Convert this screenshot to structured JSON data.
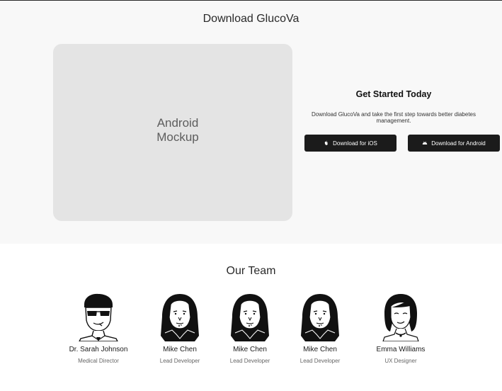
{
  "download": {
    "title": "Download GlucoVa",
    "mockup_label": "Android\nMockup",
    "cta_heading": "Get Started Today",
    "cta_text": "Download GlucoVa and take the first step towards better diabetes management.",
    "ios_button": {
      "label": "Download for iOS",
      "icon": "apple-icon"
    },
    "android_button": {
      "label": "Download for Android",
      "icon": "android-icon"
    }
  },
  "team": {
    "title": "Our Team",
    "members": [
      {
        "name": "Dr. Sarah Johnson",
        "role": "Medical Director",
        "avatar": "sunglasses-man-avatar"
      },
      {
        "name": "Mike Chen",
        "role": "Lead Developer",
        "avatar": "hijab-woman-avatar"
      },
      {
        "name": "Mike Chen",
        "role": "Lead Developer",
        "avatar": "hijab-woman-avatar"
      },
      {
        "name": "Mike Chen",
        "role": "Lead Developer",
        "avatar": "hijab-woman-avatar"
      },
      {
        "name": "Emma Williams",
        "role": "UX Designer",
        "avatar": "woman-avatar"
      }
    ]
  }
}
